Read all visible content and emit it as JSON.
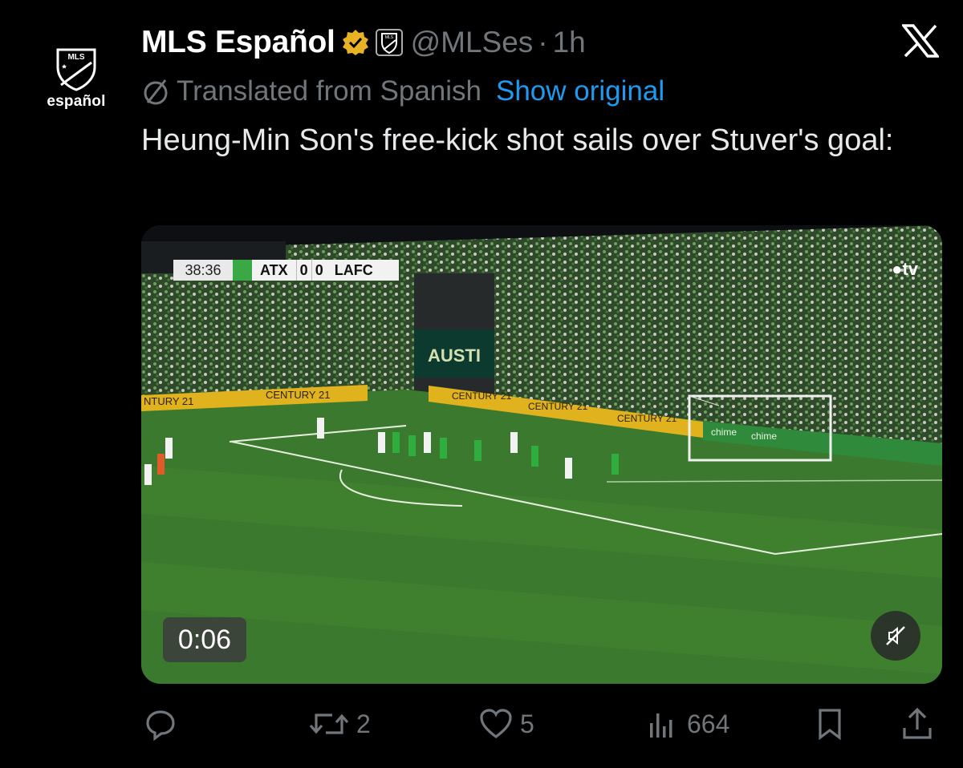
{
  "account": {
    "avatar_label": "español",
    "avatar_logo_text": "MLS",
    "name": "MLS Español",
    "handle": "@MLSes",
    "separator": "·",
    "time": "1h"
  },
  "translation": {
    "text": "Translated from Spanish",
    "link": "Show original"
  },
  "tweet": {
    "text": "Heung-Min Son's free-kick shot sails over Stuver's goal:"
  },
  "video": {
    "scorebug": {
      "clock": "38:36",
      "home": "ATX",
      "home_score": "0",
      "away_score": "0",
      "away": "LAFC"
    },
    "broadcaster": "tv",
    "elapsed": "0:06",
    "ads": [
      "NTURY 21",
      "CENTURY 21",
      "CENTURY 21",
      "CENTURY 21",
      "CENTURY 21",
      "chime",
      "chime"
    ],
    "stadium_sign": "AUSTI"
  },
  "actions": {
    "replies": "",
    "reposts": "2",
    "likes": "5",
    "views": "664"
  },
  "colors": {
    "background": "#000000",
    "link": "#1d9bf0",
    "muted": "#71767b",
    "verified_gold": "#e8b227",
    "pitch": "#3b7a2e"
  }
}
